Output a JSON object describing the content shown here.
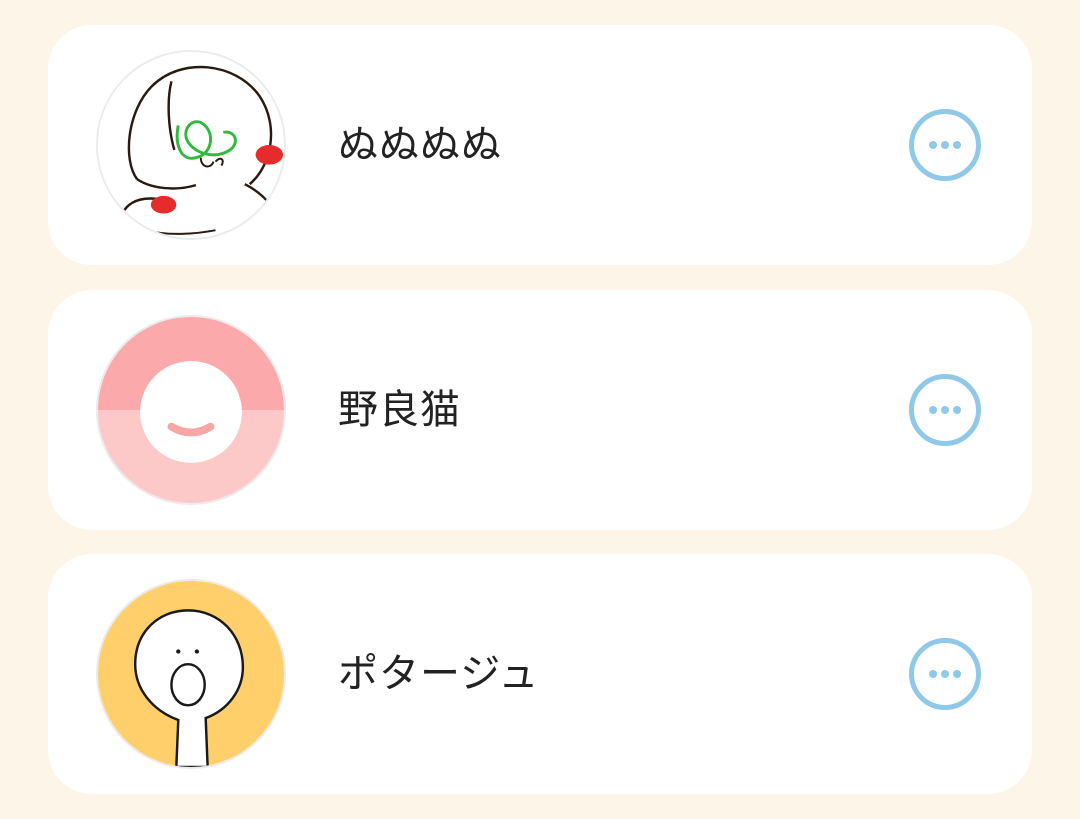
{
  "contacts": [
    {
      "name": "ぬぬぬぬ",
      "avatar_icon": "hand-drawn-face-avatar-icon",
      "action_icon": "more-options-icon"
    },
    {
      "name": "野良猫",
      "avatar_icon": "smiling-pink-circle-avatar-icon",
      "action_icon": "more-options-icon"
    },
    {
      "name": "ポタージュ",
      "avatar_icon": "surprised-face-yellow-avatar-icon",
      "action_icon": "more-options-icon"
    }
  ],
  "colors": {
    "background": "#fdf6e8",
    "card": "#ffffff",
    "accent_button": "#8fc8e8",
    "text": "#222222"
  }
}
